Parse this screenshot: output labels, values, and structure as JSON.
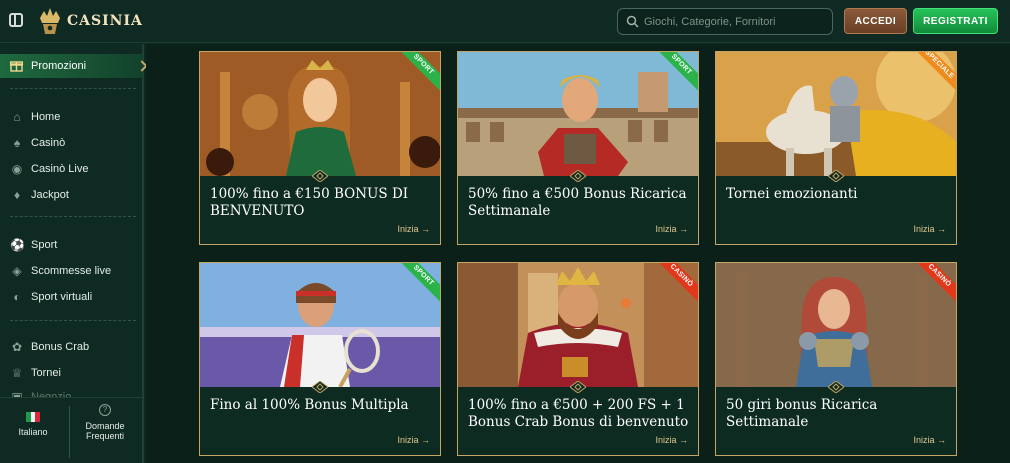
{
  "header": {
    "logo_text": "CASINIA",
    "search_placeholder": "Giochi, Categorie, Fornitori",
    "login_label": "ACCEDI",
    "register_label": "REGISTRATI"
  },
  "sidebar": {
    "active_item": {
      "label": "Promozioni",
      "icon": "gift-icon"
    },
    "groups": [
      [
        {
          "label": "Home",
          "icon": "home-icon"
        },
        {
          "label": "Casinò",
          "icon": "casino-icon"
        },
        {
          "label": "Casinò Live",
          "icon": "live-casino-icon"
        },
        {
          "label": "Jackpot",
          "icon": "jackpot-icon"
        }
      ],
      [
        {
          "label": "Sport",
          "icon": "sport-ball-icon"
        },
        {
          "label": "Scommesse live",
          "icon": "live-bets-icon"
        },
        {
          "label": "Sport virtuali",
          "icon": "virtual-sport-icon"
        }
      ],
      [
        {
          "label": "Bonus Crab",
          "icon": "crab-icon"
        },
        {
          "label": "Tornei",
          "icon": "trophy-icon"
        },
        {
          "label": "Negozio",
          "icon": "shop-icon"
        }
      ]
    ],
    "bottom": {
      "language_label": "Italiano",
      "faq_label_line1": "Domande",
      "faq_label_line2": "Frequenti"
    }
  },
  "promotions": [
    {
      "title": "100% fino a €150 BONUS DI BENVENUTO",
      "badge": "SPORT",
      "badge_color": "#2bb34a",
      "cta": "Inizia →"
    },
    {
      "title": "50% fino a €500 Bonus Ricarica Settimanale",
      "badge": "SPORT",
      "badge_color": "#2bb34a",
      "cta": "Inizia →"
    },
    {
      "title": "Tornei emozionanti",
      "badge": "SPECIALE",
      "badge_color": "#ef8a1d",
      "cta": "Inizia →"
    },
    {
      "title": "Fino al 100% Bonus Multipla",
      "badge": "SPORT",
      "badge_color": "#2bb34a",
      "cta": "Inizia →"
    },
    {
      "title": "100% fino a €500 + 200 FS + 1 Bonus Crab Bonus di benvenuto",
      "badge": "CASINÒ",
      "badge_color": "#e1371b",
      "cta": "Inizia →"
    },
    {
      "title": "50 giri bonus Ricarica Settimanale",
      "badge": "CASINÒ",
      "badge_color": "#e1371b",
      "cta": "Inizia →"
    }
  ],
  "colors": {
    "accent_gold": "#c4a566",
    "register_green": "#26c25a",
    "login_brown": "#8a5a3a",
    "background": "#0d2a22"
  }
}
